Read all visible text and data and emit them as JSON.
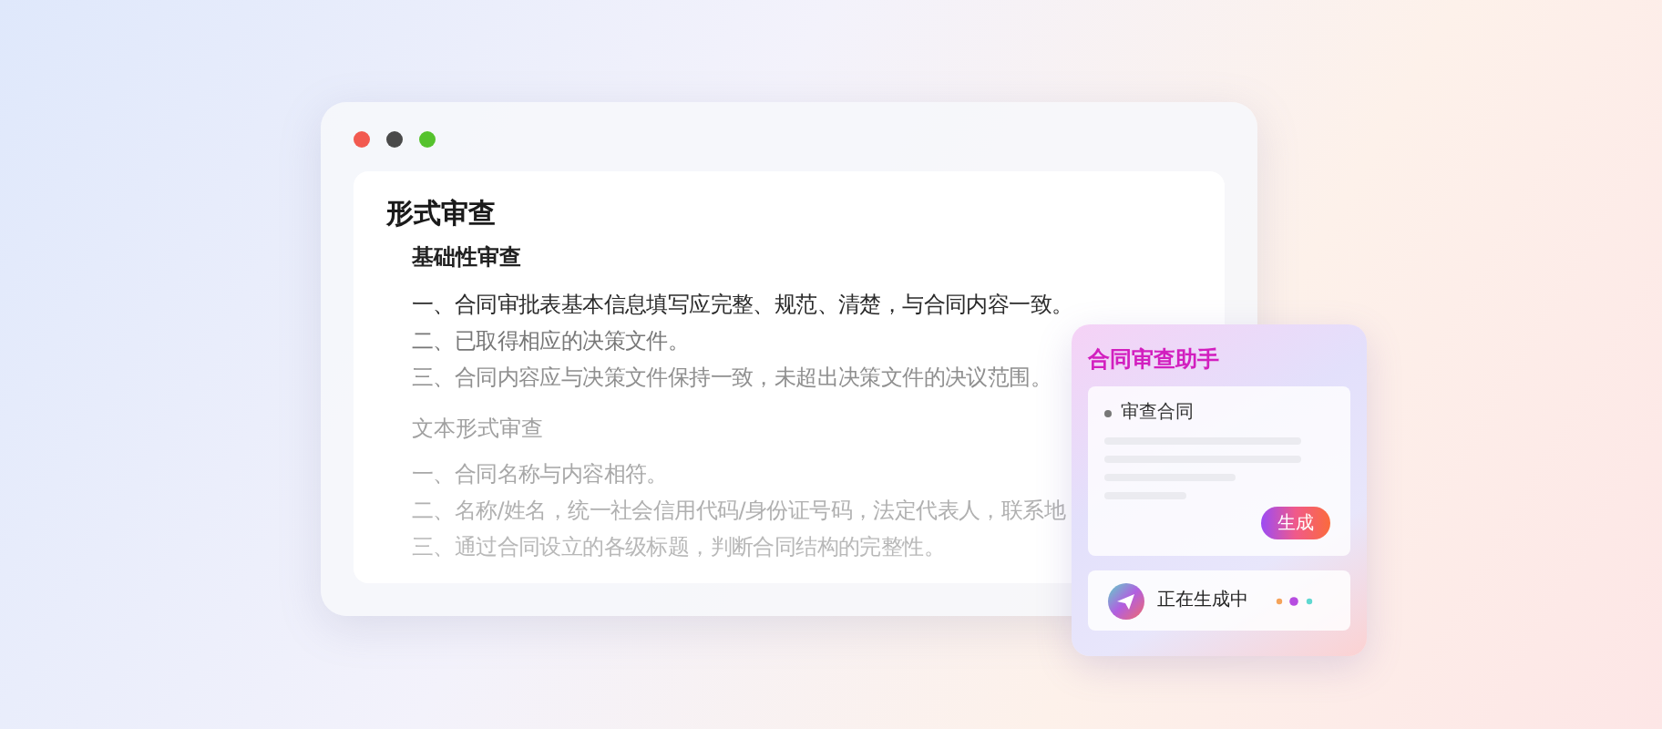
{
  "document": {
    "title": "形式审查",
    "sections": [
      {
        "heading": "基础性审查",
        "lines": [
          "一、合同审批表基本信息填写应完整、规范、清楚，与合同内容一致。",
          "二、已取得相应的决策文件。",
          "三、合同内容应与决策文件保持一致，未超出决策文件的决议范围。"
        ]
      },
      {
        "heading": "文本形式审查",
        "lines": [
          "一、合同名称与内容相符。",
          "二、名称/姓名，统一社会信用代码/身份证号码，法定代表人，联系地",
          "三、通过合同设立的各级标题，判断合同结构的完整性。"
        ]
      }
    ]
  },
  "assistant": {
    "title": "合同审查助手",
    "task": "审查合同",
    "button": "生成",
    "status": "正在生成中"
  }
}
